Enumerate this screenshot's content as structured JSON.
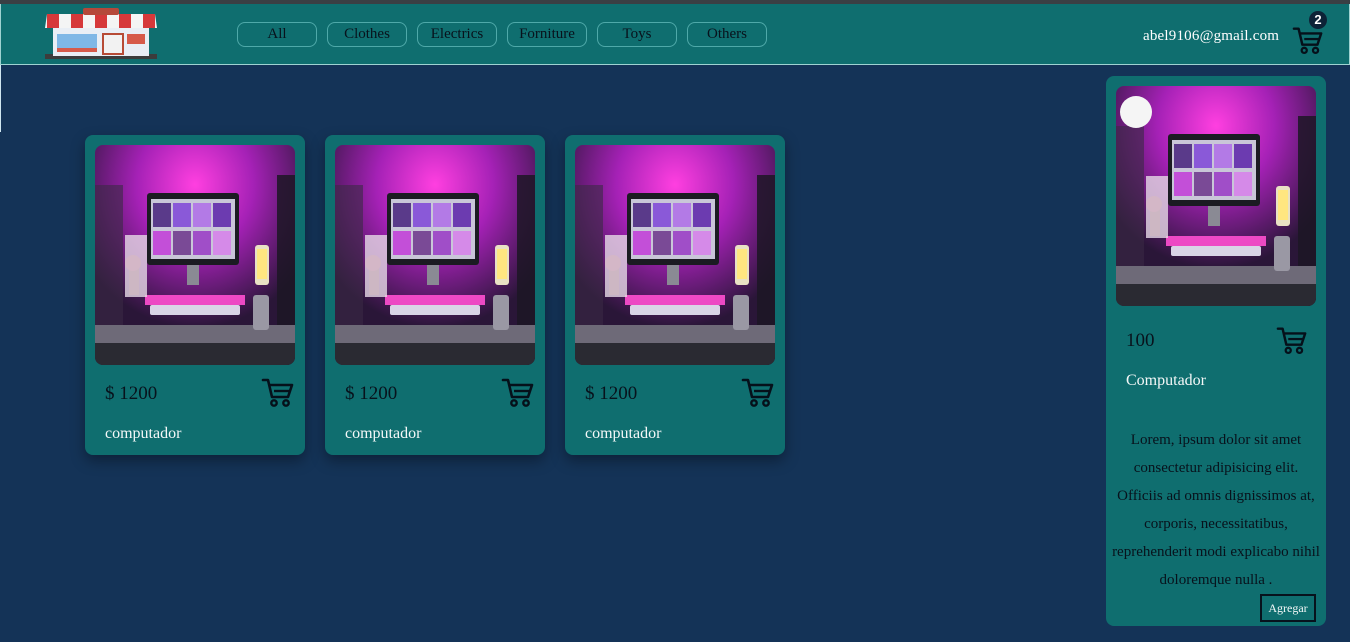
{
  "nav": {
    "categories": [
      "All",
      "Clothes",
      "Electrics",
      "Forniture",
      "Toys",
      "Others"
    ],
    "user_email": "abel9106@gmail.com",
    "cart_count": "2"
  },
  "products": [
    {
      "price": "$ 1200",
      "title": "computador",
      "image": "computer-desk-photo"
    },
    {
      "price": "$ 1200",
      "title": "computador",
      "image": "computer-desk-photo"
    },
    {
      "price": "$ 1200",
      "title": "computador",
      "image": "computer-desk-photo"
    }
  ],
  "detail": {
    "price": "100",
    "title": "Computador",
    "description": "Lorem, ipsum dolor sit amet consectetur adipisicing elit. Officiis ad omnis dignissimos at, corporis, necessitatibus, reprehenderit modi explicabo nihil doloremque nulla .",
    "add_label": "Agregar"
  },
  "colors": {
    "background": "#143357",
    "navbar": "#0f6e6f",
    "card": "#0f6e6f",
    "accent_glow": "#ff2bd6"
  },
  "icons": [
    "store-logo",
    "cart-icon",
    "close-icon"
  ]
}
